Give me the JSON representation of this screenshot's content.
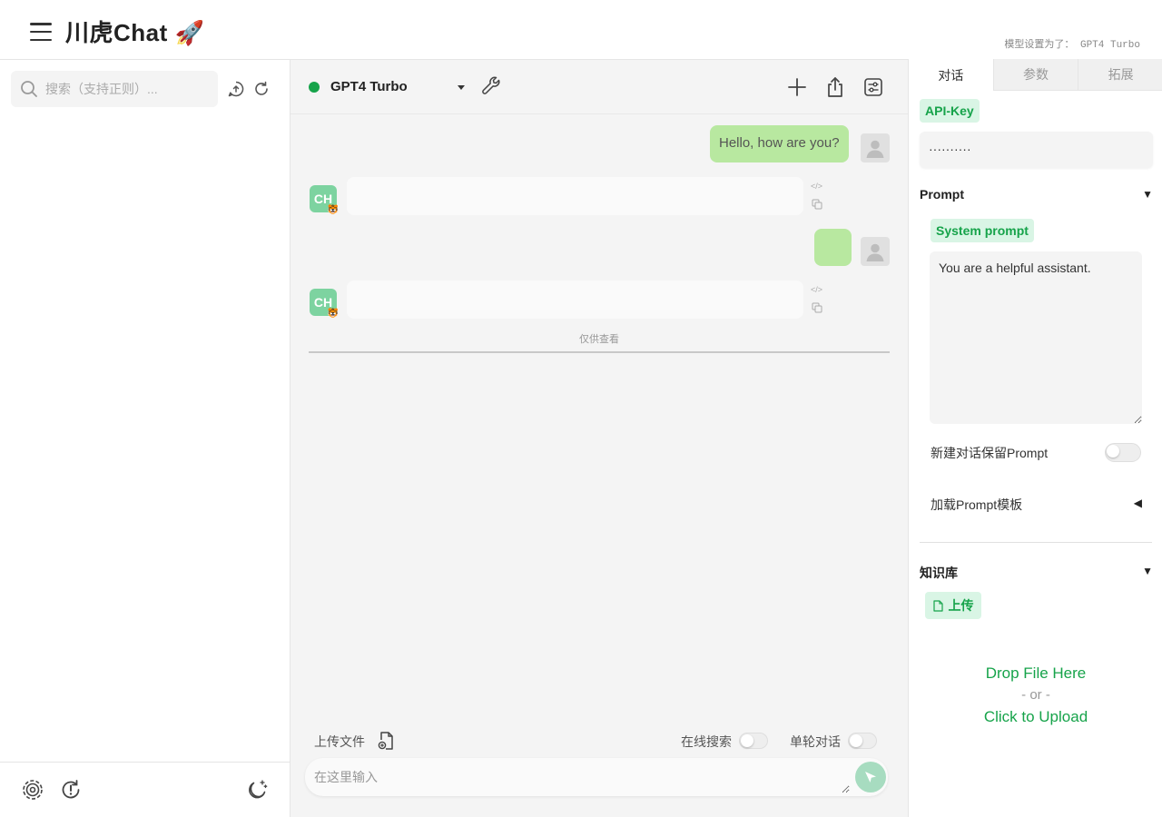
{
  "header": {
    "title": "川虎Chat 🚀",
    "model_status": "模型设置为了： GPT4 Turbo"
  },
  "sidebar": {
    "search_placeholder": "搜索（支持正则）...",
    "footer_icons": [
      "settings-icon",
      "history-icon",
      "dark-mode-icon"
    ]
  },
  "chat": {
    "model_name": "GPT4 Turbo",
    "status_color": "#16a34a",
    "messages": [
      {
        "role": "user",
        "text": "Hello, how are you?"
      },
      {
        "role": "assistant",
        "text": ""
      },
      {
        "role": "user",
        "text": ""
      },
      {
        "role": "assistant",
        "text": ""
      }
    ],
    "view_only_label": "仅供查看",
    "upload_file_label": "上传文件",
    "online_search_label": "在线搜索",
    "single_turn_label": "单轮对话",
    "input_placeholder": "在这里输入"
  },
  "right_panel": {
    "tabs": [
      {
        "label": "对话",
        "active": true
      },
      {
        "label": "参数",
        "active": false
      },
      {
        "label": "拓展",
        "active": false
      }
    ],
    "api_key_label": "API-Key",
    "api_key_value": "··········",
    "prompt_section_title": "Prompt",
    "system_prompt_label": "System prompt",
    "system_prompt_value": "You are a helpful assistant.",
    "keep_prompt_label": "新建对话保留Prompt",
    "load_template_label": "加载Prompt模板",
    "knowledge_section_title": "知识库",
    "upload_label": "上传",
    "drop_file_label": "Drop File Here",
    "or_label": "- or -",
    "click_upload_label": "Click to Upload"
  },
  "colors": {
    "accent_green": "#16a34a",
    "user_bubble": "#b8e8a0",
    "chip_bg": "#d9f5e5"
  }
}
